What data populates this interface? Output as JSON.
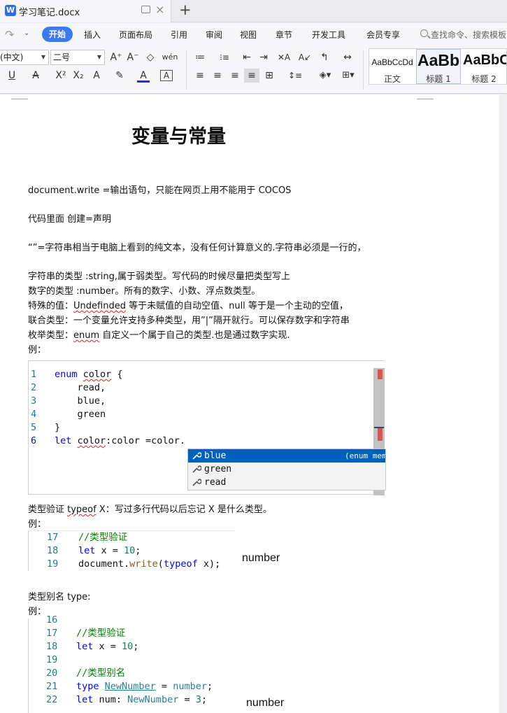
{
  "titlebar": {
    "logo": "W",
    "doc_title": "学习笔记.docx",
    "new_tab": "+",
    "close_tab": "×"
  },
  "menubar": {
    "undo_icon": "redo-icon",
    "dropdown": "⌄",
    "start": "开始",
    "items": [
      "插入",
      "页面布局",
      "引用",
      "审阅",
      "视图",
      "章节",
      "开发工具",
      "会员专享"
    ],
    "search_placeholder": "查找命令、搜索模板"
  },
  "toolbar": {
    "font_name": "(中文)",
    "font_size": "二号",
    "row1": [
      "A⁺",
      "A⁻",
      "◇",
      "wén",
      "≔",
      "⁝≡",
      "⇤",
      "⇥",
      "✕A",
      "A↙",
      "↰",
      "↔"
    ],
    "row2": [
      "U",
      "A",
      "X²",
      "X₂",
      "A",
      "✎",
      "A",
      "A"
    ],
    "align": [
      "≡",
      "≡",
      "≡",
      "≡",
      "⊞"
    ],
    "styles": [
      {
        "preview": "AaBbCcDd",
        "name": "正文"
      },
      {
        "preview": "AaBb",
        "name": "标题 1"
      },
      {
        "preview": "AaBbC",
        "name": "标题 2"
      }
    ]
  },
  "doc": {
    "heading": "变量与常量",
    "p1": "document.write =输出语句，只能在网页上用不能用于 COCOS",
    "p2": "代码里面 创建=声明",
    "p3": "“”=字符串相当于电脑上看到的纯文本，没有任何计算意义的.字符串必须是一行的，",
    "l1": "字符串的类型 :string,属于弱类型。写代码的时候尽量把类型写上",
    "l2": "数字的类型 :number。所有的数字、小数、浮点数类型。",
    "l3a": "特殊的值：",
    "l3b": "Undefinded",
    "l3c": " 等于未赋值的自动空值、null 等于是一个主动的空值，",
    "l4": "联合类型：一个变量允许支持多种类型，用”|”隔开就行。可以保存数字和字符串",
    "l5a": "枚举类型：",
    "l5b": "enum",
    "l5c": " 自定义一个属于自己的类型.也是通过数字实现.",
    "l6": "例：",
    "p4a": "类型验证 ",
    "p4b": "typeof",
    "p4c": " X：写过多行代码以后忘记 X 是什么类型。",
    "p5": "例：",
    "p6": "类型别名  type:",
    "p7": "例："
  },
  "code1": {
    "lines": [
      {
        "n": "1",
        "parts": [
          [
            "kw",
            "enum "
          ],
          [
            "sq",
            "color"
          ],
          [
            "",
            " {"
          ]
        ]
      },
      {
        "n": "2",
        "parts": [
          [
            "",
            "    read,"
          ]
        ]
      },
      {
        "n": "3",
        "parts": [
          [
            "",
            "    blue,"
          ]
        ]
      },
      {
        "n": "4",
        "parts": [
          [
            "",
            "    green"
          ]
        ]
      },
      {
        "n": "5",
        "parts": [
          [
            "",
            "}"
          ]
        ]
      },
      {
        "n": "6",
        "parts": [
          [
            "kw",
            "let "
          ],
          [
            "sq",
            "color"
          ],
          [
            "",
            ":color =color."
          ]
        ]
      }
    ],
    "suggestions": [
      {
        "label": "blue",
        "detail": "(enum mem"
      },
      {
        "label": "green",
        "detail": ""
      },
      {
        "label": "read",
        "detail": ""
      }
    ]
  },
  "code2": {
    "lines": [
      {
        "n": "17",
        "parts": [
          [
            "cmt",
            "//类型验证"
          ]
        ]
      },
      {
        "n": "18",
        "parts": [
          [
            "kw",
            "let"
          ],
          [
            "",
            " x = "
          ],
          [
            "num",
            "10"
          ],
          [
            "",
            ";"
          ]
        ]
      },
      {
        "n": "19",
        "parts": [
          [
            "",
            "document."
          ],
          [
            "fn",
            "write"
          ],
          [
            "",
            "("
          ],
          [
            "kw",
            "typeof"
          ],
          [
            "",
            " x);"
          ]
        ]
      }
    ],
    "result": "number"
  },
  "code3": {
    "lines": [
      {
        "n": "16",
        "parts": []
      },
      {
        "n": "17",
        "parts": [
          [
            "cmt",
            "//类型验证"
          ]
        ]
      },
      {
        "n": "18",
        "parts": [
          [
            "kw",
            "let"
          ],
          [
            "",
            " x = "
          ],
          [
            "num",
            "10"
          ],
          [
            "",
            ";"
          ]
        ]
      },
      {
        "n": "19",
        "parts": []
      },
      {
        "n": "20",
        "parts": [
          [
            "cmt",
            "//类型别名"
          ]
        ]
      },
      {
        "n": "21",
        "parts": [
          [
            "kw",
            "type "
          ],
          [
            "link",
            "NewNumber"
          ],
          [
            "",
            " = "
          ],
          [
            "typ",
            "number"
          ],
          [
            "",
            ";"
          ]
        ]
      },
      {
        "n": "22",
        "parts": [
          [
            "kw",
            "let"
          ],
          [
            "",
            " num: "
          ],
          [
            "typ",
            "NewNumber"
          ],
          [
            "",
            " = "
          ],
          [
            "num",
            "3"
          ],
          [
            "",
            ";"
          ]
        ]
      }
    ],
    "result": "number"
  }
}
